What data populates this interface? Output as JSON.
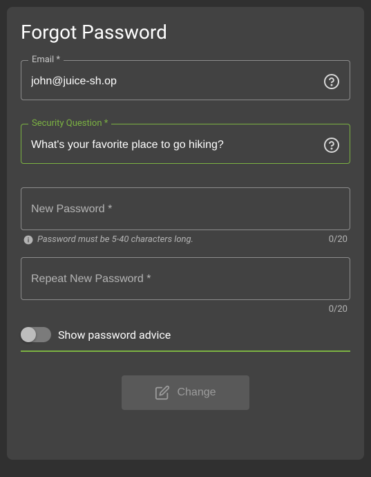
{
  "title": "Forgot Password",
  "email": {
    "label": "Email *",
    "value": "john@juice-sh.op"
  },
  "securityQuestion": {
    "label": "Security Question *",
    "value": "What's your favorite place to go hiking?"
  },
  "newPassword": {
    "label": "New Password *",
    "hint": "Password must be 5-40 characters long.",
    "counter": "0/20"
  },
  "repeatPassword": {
    "label": "Repeat New Password *",
    "counter": "0/20"
  },
  "toggle": {
    "label": "Show password advice"
  },
  "button": {
    "label": "Change"
  }
}
